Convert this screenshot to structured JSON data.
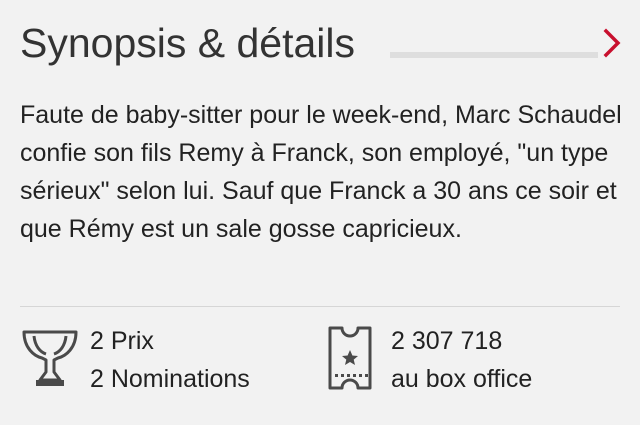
{
  "section": {
    "title": "Synopsis & détails",
    "accent_color": "#c8102e",
    "chevron_icon": "chevron-right-icon"
  },
  "synopsis": {
    "text": "Faute de baby-sitter pour le week-end, Marc Schaudel confie son fils Remy à Franck, son employé, \"un type sérieux\" selon lui. Sauf que Franck a 30 ans ce soir et que Rémy est un sale gosse capricieux."
  },
  "awards": {
    "icon": "trophy-icon",
    "prizes": "2 Prix",
    "nominations": "2 Nominations"
  },
  "box_office": {
    "icon": "ticket-icon",
    "entries": "2 307 718",
    "label": "au box office"
  }
}
